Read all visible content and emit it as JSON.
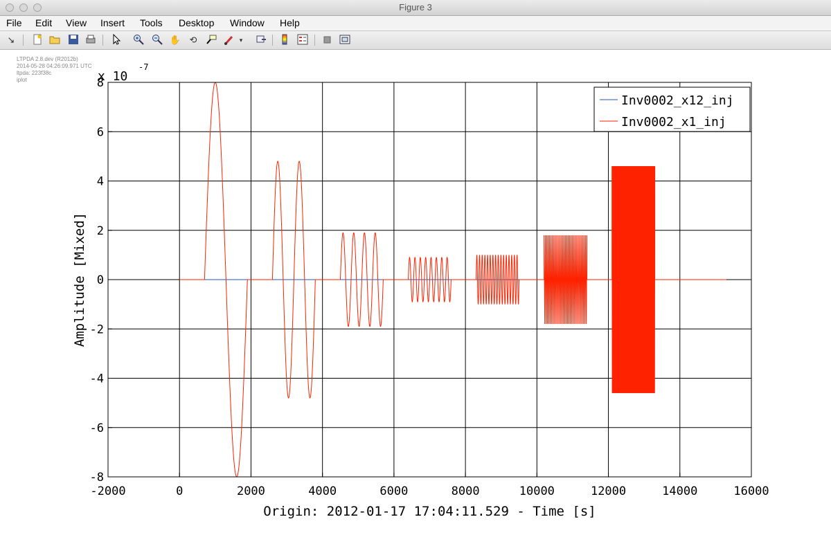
{
  "window": {
    "title": "Figure 3"
  },
  "menu": [
    "File",
    "Edit",
    "View",
    "Insert",
    "Tools",
    "Desktop",
    "Window",
    "Help"
  ],
  "toolbar": {
    "icons": [
      "dock-arrow-icon",
      "new-figure-icon",
      "open-file-icon",
      "save-icon",
      "print-icon",
      "select-arrow-icon",
      "zoom-in-icon",
      "zoom-out-icon",
      "pan-hand-icon",
      "rotate-3d-icon",
      "data-cursor-icon",
      "brush-icon",
      "brush-dropdown-icon",
      "link-plot-icon",
      "colorbar-icon",
      "legend-icon",
      "hide-plot-tools-icon",
      "show-plot-tools-icon"
    ]
  },
  "stamp": {
    "line1": "LTPDA 2.8.dev (R2012b)",
    "line2": "2014-05-28 04:26:09.971 UTC",
    "line3": "ltpda: 223f38c",
    "line4": "iplot"
  },
  "chart_data": {
    "type": "line",
    "title": "",
    "xlabel": "Origin: 2012-01-17 17:04:11.529 - Time  [s]",
    "ylabel": "Amplitude  [Mixed]",
    "xlim": [
      -2000,
      16000
    ],
    "ylim": [
      -8,
      8
    ],
    "y_exponent_label": "x 10",
    "y_exponent_power": "-7",
    "xticks": [
      -2000,
      0,
      2000,
      4000,
      6000,
      8000,
      10000,
      12000,
      14000,
      16000
    ],
    "xtick_labels": [
      "-2000",
      "0",
      "2000",
      "4000",
      "6000",
      "8000",
      "10000",
      "12000",
      "14000",
      "16000"
    ],
    "yticks": [
      -8,
      -6,
      -4,
      -2,
      0,
      2,
      4,
      6,
      8
    ],
    "ytick_labels": [
      "-8",
      "-6",
      "-4",
      "-2",
      "0",
      "2",
      "4",
      "6",
      "8"
    ],
    "grid": true,
    "legend_position": "top-right",
    "series": [
      {
        "name": "Inv0002_x12_inj",
        "color": "#2255bb",
        "x_range": [
          0,
          15300
        ],
        "value": 0
      },
      {
        "name": "Inv0002_x1_inj",
        "color": "#ff2200",
        "x_range": [
          0,
          15300
        ],
        "baseline": 0
      }
    ],
    "bursts": [
      {
        "x_start": 700,
        "x_end": 1900,
        "amplitude": 8,
        "cycles": 1
      },
      {
        "x_start": 2600,
        "x_end": 3800,
        "amplitude": 4.8,
        "cycles": 2
      },
      {
        "x_start": 4500,
        "x_end": 5700,
        "amplitude": 1.9,
        "cycles": 4
      },
      {
        "x_start": 6400,
        "x_end": 7600,
        "amplitude": 0.9,
        "cycles": 8
      },
      {
        "x_start": 8300,
        "x_end": 9500,
        "amplitude": 1.0,
        "cycles": 16
      },
      {
        "x_start": 10200,
        "x_end": 11400,
        "amplitude": 1.8,
        "cycles": 32
      },
      {
        "x_start": 12100,
        "x_end": 13300,
        "amplitude": 4.6,
        "cycles": 64
      }
    ]
  }
}
